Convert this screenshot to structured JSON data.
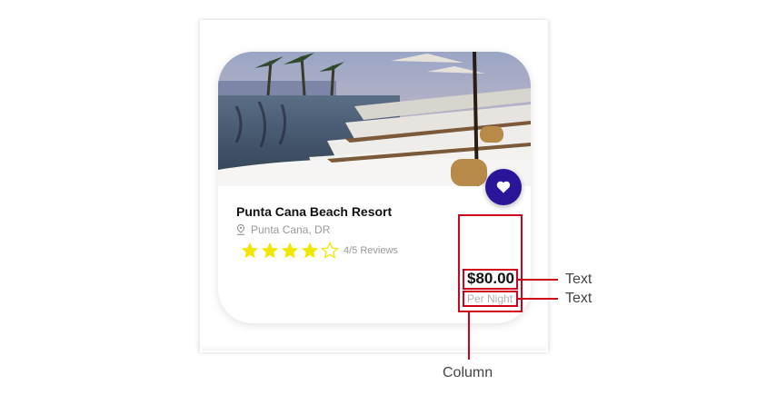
{
  "hotel": {
    "name": "Punta Cana Beach Resort",
    "location": "Punta Cana, DR",
    "rating": 4,
    "rating_max": 5,
    "reviews_label": "4/5 Reviews",
    "price": "$80.00",
    "per_label": "Per Night"
  },
  "annotations": {
    "price_label": "Text",
    "per_label": "Text",
    "column_label": "Column"
  },
  "colors": {
    "accent": "#2a1599",
    "star": "#f3e600",
    "highlight": "#d0021b"
  },
  "icons": [
    "heart-icon",
    "location-pin-icon",
    "star-icon"
  ]
}
